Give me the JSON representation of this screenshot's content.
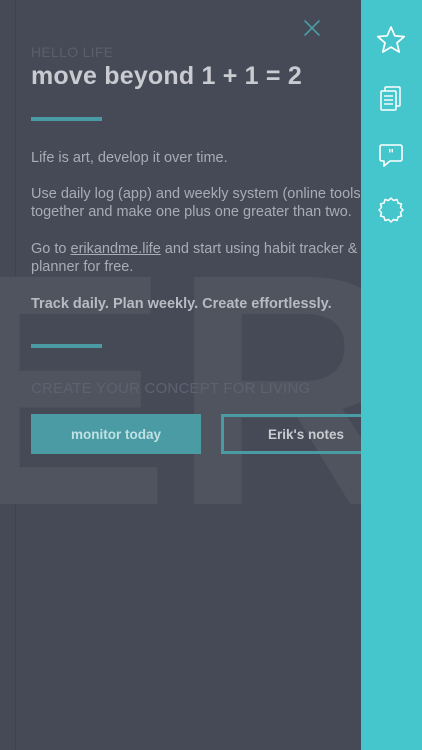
{
  "watermark": "ERI",
  "header": {
    "kicker": "HELLO LIFE",
    "title": "move beyond 1 + 1 = 2"
  },
  "body": {
    "p1": "Life is art, develop it over time.",
    "p2": "Use daily log (app) and weekly system (online tools) together and make one plus one greater than two.",
    "p3_before": "Go to ",
    "p3_link": "erikandme.life",
    "p3_after": " and start using habit tracker & planner for free.",
    "p4": "Track daily. Plan weekly. Create effortlessly."
  },
  "concept": {
    "subhead": "CREATE YOUR CONCEPT FOR LIVING",
    "primary_button": "monitor today",
    "secondary_button": "Erik's notes"
  },
  "sidebar": {
    "icons": [
      "star-icon",
      "notes-icon",
      "quote-bubble-icon",
      "gear-icon"
    ]
  },
  "colors": {
    "background": "#464a57",
    "accent": "#4a9ba3",
    "sidebar": "#45c6cc",
    "close_icon": "#4a9ba3"
  }
}
